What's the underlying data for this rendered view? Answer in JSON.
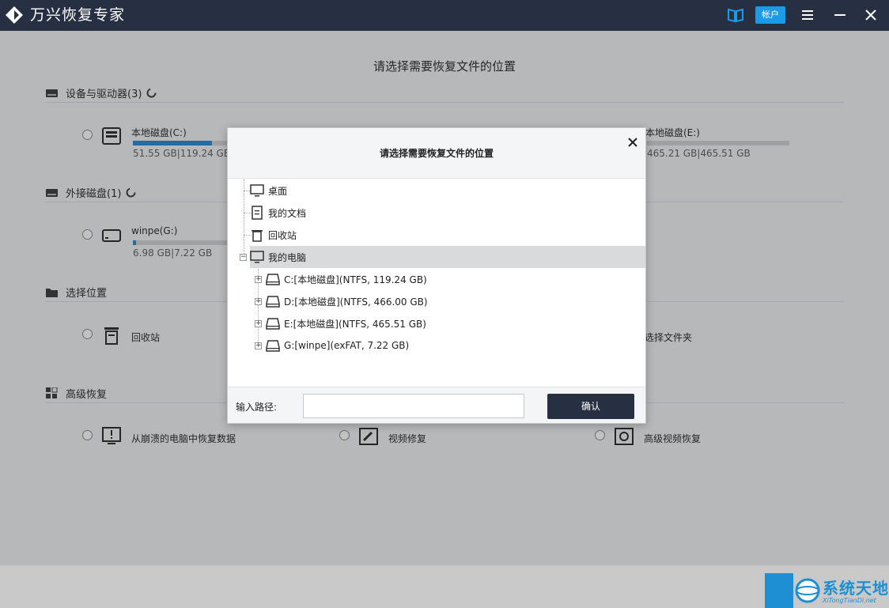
{
  "app": {
    "title": "万兴恢复专家",
    "account_label": "帐户"
  },
  "main": {
    "heading": "请选择需要恢复文件的位置",
    "sections": {
      "drives": {
        "title": "设备与驱动器(3)"
      },
      "external": {
        "title": "外接磁盘(1)"
      },
      "location": {
        "title": "选择位置"
      },
      "advanced": {
        "title": "高级恢复"
      }
    },
    "drives": [
      {
        "name": "本地磁盘(C:)",
        "size": "51.55 GB|119.24 GB",
        "used_fraction": 0.43
      },
      {
        "name": "本地磁盘(E:)",
        "size": "465.21 GB|465.51 GB",
        "used_fraction": 0.0
      }
    ],
    "external": [
      {
        "name": "winpe(G:)",
        "size": "6.98 GB|7.22 GB",
        "used_fraction": 0.03
      }
    ],
    "locations": {
      "recycle": "回收站",
      "folder": "选择文件夹"
    },
    "advanced": {
      "crash": "从崩溃的电脑中恢复数据",
      "video": "视频修复",
      "adv_video": "高级视频恢复"
    }
  },
  "dialog": {
    "title": "请选择需要恢复文件的位置",
    "tree": {
      "desktop": "桌面",
      "documents": "我的文档",
      "recycle": "回收站",
      "computer": "我的电脑",
      "drives": [
        "C:[本地磁盘](NTFS, 119.24 GB)",
        "D:[本地磁盘](NTFS, 466.00 GB)",
        "E:[本地磁盘](NTFS, 465.51 GB)",
        "G:[winpe](exFAT, 7.22 GB)"
      ]
    },
    "path_label": "输入路径:",
    "path_value": "",
    "confirm_label": "确认"
  },
  "watermark": {
    "text": "系统天地",
    "sub": "XiTongTianDi.net"
  },
  "colors": {
    "titlebar": "#273043",
    "accent": "#1a9be8",
    "bar_fill": "#2f8fd6"
  }
}
